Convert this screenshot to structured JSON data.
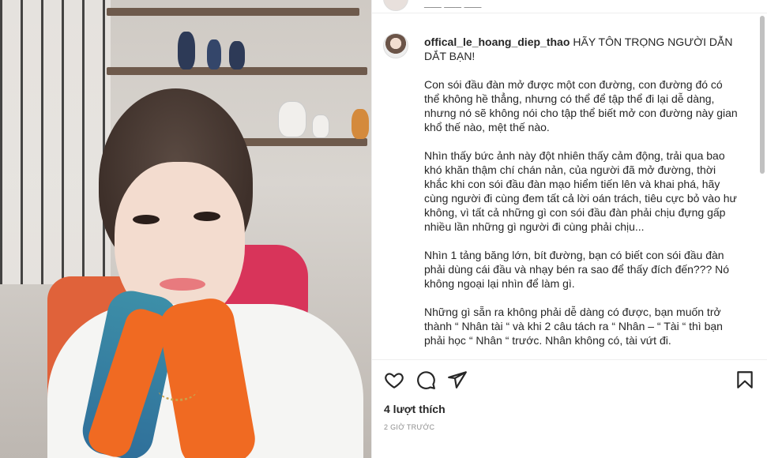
{
  "post": {
    "top_username": "___ ___ ___",
    "username": "offical_le_hoang_diep_thao",
    "caption_first": "HÃY TÔN TRỌNG NGƯỜI DẪN DẮT BẠN!",
    "paragraphs": [
      "Con sói đầu đàn mở được một con đường, con đường đó có thể không hề thẳng, nhưng có thể để tập thể đi lại dễ dàng, nhưng nó sẽ không nói cho tập thể biết mở con đường này gian khổ thế nào, mệt thế nào.",
      "Nhìn thấy bức ảnh này đột nhiên thấy cảm động, trải qua bao khó khăn thậm chí chán nản, của người đã mở đường, thời khắc khi con sói đầu đàn mạo hiểm tiến lên và khai phá, hãy cùng người đi cùng đem tất cả lời oán trách, tiêu cực bỏ vào hư không, vì tất cả những gì con sói đầu đàn phải chịu đựng gấp nhiều lần những gì người đi cùng phải chịu...",
      "Nhìn 1 tảng băng lớn, bít đường, bạn có biết con sói đầu đàn phải dùng cái đầu và nhạy bén ra sao để thấy đích đến??? Nó không ngoại lại nhìn để làm gì.",
      "Những gì sẵn ra không phải dễ dàng có được, bạn muốn trở thành “ Nhân tài “ và khi 2 câu tách ra “ Nhân – “ Tài “ thì bạn phải học “ Nhân “ trước. Nhân không có, tài vứt đi."
    ],
    "likes": "4 lượt thích",
    "time": "2 GIỜ TRƯỚC"
  },
  "icons": {
    "like": "heart-icon",
    "comment": "comment-icon",
    "share": "send-icon",
    "save": "bookmark-icon"
  }
}
